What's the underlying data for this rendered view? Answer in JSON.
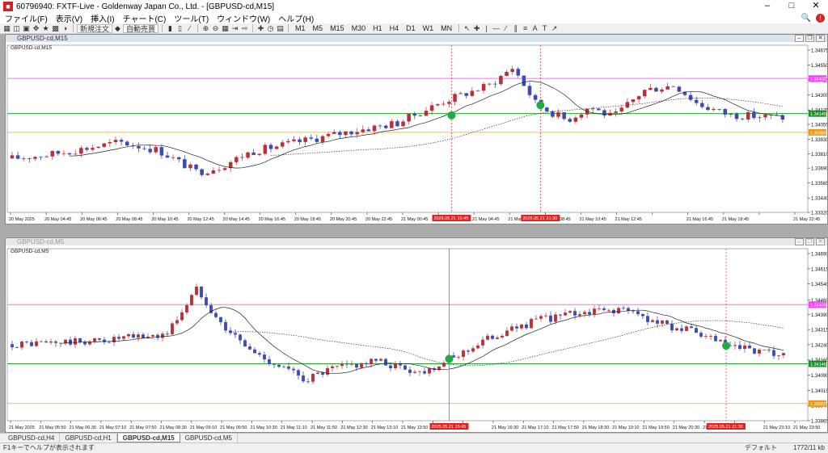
{
  "window": {
    "title": "60796940: FXTF-Live - Goldenway Japan Co., Ltd. - [GBPUSD-cd,M15]",
    "icon": "app-logo-icon"
  },
  "menu": [
    "ファイル(F)",
    "表示(V)",
    "挿入(I)",
    "チャート(C)",
    "ツール(T)",
    "ウィンドウ(W)",
    "ヘルプ(H)"
  ],
  "toolbar": {
    "new_order": "新規注文",
    "auto_trade": "自動売買",
    "timeframes": [
      "M1",
      "M5",
      "M15",
      "M30",
      "H1",
      "H4",
      "D1",
      "W1",
      "MN"
    ]
  },
  "colors": {
    "bull": "#f0f0f0",
    "bear": "#3c4bb8",
    "bull_border": "#b8303a",
    "magenta": "#ff66ff",
    "green": "#22aa33",
    "orange": "#ffbb44",
    "signal": "#22aa44"
  },
  "charts": [
    {
      "title": "GBPUSD-cd,M15",
      "label": "GBPUSD-cd,M15",
      "yticks": [
        "1.34675",
        "1.34550",
        "1.34425",
        "1.34300",
        "1.34175",
        "1.34055",
        "1.33930",
        "1.33810",
        "1.33690",
        "1.33565",
        "1.33440",
        "1.33320"
      ],
      "ymin": 1.3332,
      "ymax": 1.34675,
      "xticks": [
        "20 May 2025",
        "20 May 04:45",
        "20 May 06:45",
        "20 May 08:45",
        "20 May 10:45",
        "20 May 12:45",
        "20 May 14:45",
        "20 May 16:45",
        "20 May 18:45",
        "20 May 20:45",
        "20 May 22:45",
        "21 May 00:45",
        "21 May 02:45",
        "21 May 04:45",
        "21 May 06:45",
        "21 May 08:45",
        "21 May 10:45",
        "21 May 12:45",
        "",
        "21 May 16:45",
        "21 May 18:45",
        "",
        "21 May 22:45"
      ],
      "magenta": {
        "value": 1.34438,
        "label": "1.34438"
      },
      "green": {
        "value": 1.34145,
        "label": "1.34145"
      },
      "orange": {
        "value": 1.33988,
        "label": "1.33988"
      },
      "vlines": [
        {
          "label": "2025.05.21 15:45",
          "at": 0.555
        },
        {
          "label": "2025.05.21 21:30",
          "at": 0.666
        }
      ],
      "signals": [
        {
          "pos": 0.555,
          "price": 1.3413
        },
        {
          "pos": 0.666,
          "price": 1.34215
        }
      ],
      "count": 135
    },
    {
      "title": "GBPUSD-cd,M5",
      "label": "GBPUSD-cd,M5",
      "yticks": [
        "1.34690",
        "1.34615",
        "1.34540",
        "1.34460",
        "1.34390",
        "1.34315",
        "1.34240",
        "1.34165",
        "1.34090",
        "1.34015",
        "1.33940",
        "1.33865"
      ],
      "ymin": 1.33865,
      "ymax": 1.3469,
      "xticks": [
        "21 May 2025",
        "21 May 05:50",
        "21 May 06:30",
        "21 May 07:10",
        "21 May 07:50",
        "21 May 08:30",
        "21 May 09:10",
        "21 May 09:50",
        "21 May 10:30",
        "21 May 11:10",
        "21 May 11:50",
        "21 May 12:30",
        "21 May 13:10",
        "21 May 13:50",
        "21 May 14:30",
        "",
        "21 May 16:30",
        "21 May 17:10",
        "21 May 17:50",
        "21 May 18:30",
        "21 May 19:10",
        "21 May 19:50",
        "21 May 20:30",
        "21 May 21:10",
        "",
        "21 May 23:10",
        "21 May 23:50"
      ],
      "magenta": {
        "value": 1.34438,
        "label": "1.34438"
      },
      "green": {
        "value": 1.34146,
        "label": "1.34146"
      },
      "orange": {
        "value": 1.3395,
        "label": "1.33950"
      },
      "vlines": [
        {
          "label": "2025.05.21 15:45",
          "at": 0.552
        },
        {
          "label": "2025.05.21 21:30",
          "at": 0.898
        }
      ],
      "signals": [
        {
          "pos": 0.552,
          "price": 1.3417
        },
        {
          "pos": 0.898,
          "price": 1.34235
        }
      ],
      "count": 160
    }
  ],
  "tabs": [
    "GBPUSD-cd,H4",
    "GBPUSD-cd,H1",
    "GBPUSD-cd,M15",
    "GBPUSD-cd,M5"
  ],
  "active_tab": 2,
  "status": {
    "help": "F1キーでヘルプが表示されます",
    "profile": "デフォルト",
    "traffic": "1772/11 kb"
  }
}
